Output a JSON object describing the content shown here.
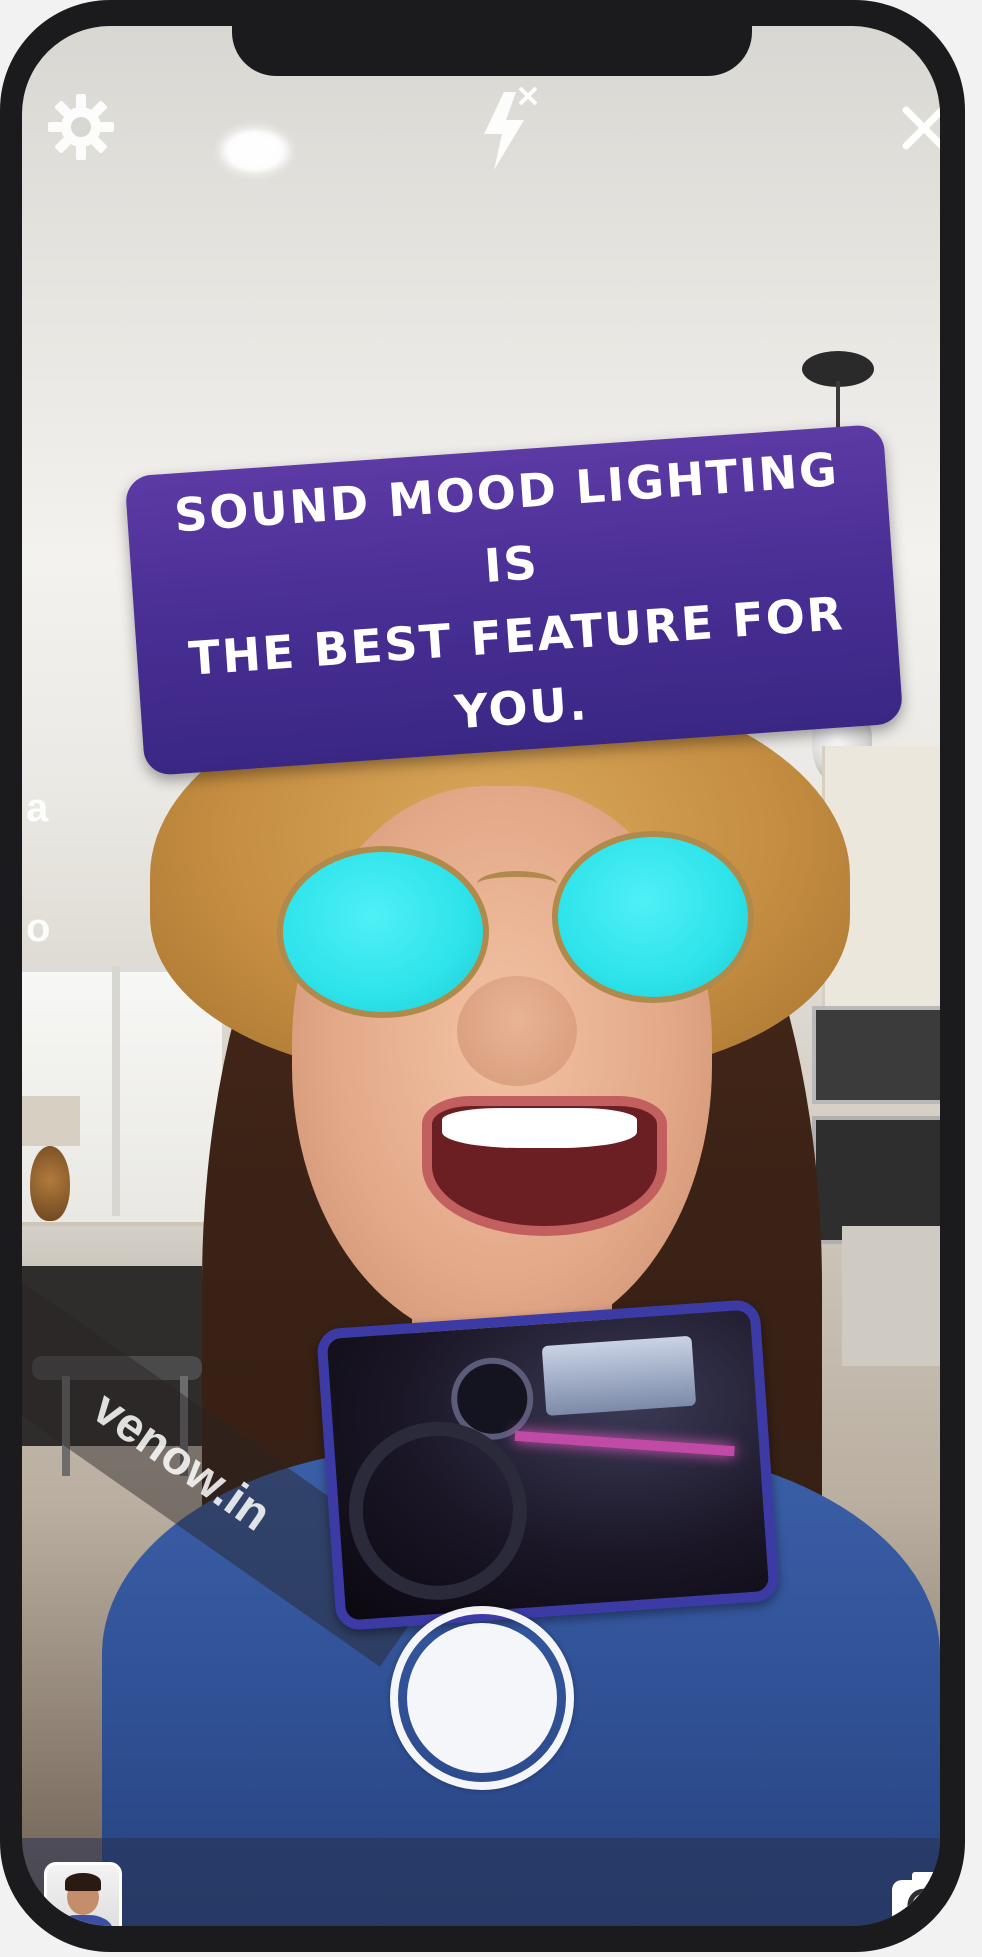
{
  "banner": {
    "line1": "SOUND MOOD LIGHTING IS",
    "line2": "THE BEST FEATURE FOR YOU."
  },
  "watermark": {
    "text": "venow.in"
  },
  "edge_text": {
    "left_a": "a",
    "left_o": "o"
  },
  "icons": {
    "settings": "settings-gear-icon",
    "flash": "flash-off-icon",
    "close": "close-icon",
    "flip_camera": "flip-camera-icon",
    "gallery": "gallery-thumbnail"
  },
  "colors": {
    "banner_top": "#5d3aa5",
    "banner_bottom": "#3a2784",
    "card_border": "#3c3ba6",
    "lens": "#2ee3ea"
  }
}
